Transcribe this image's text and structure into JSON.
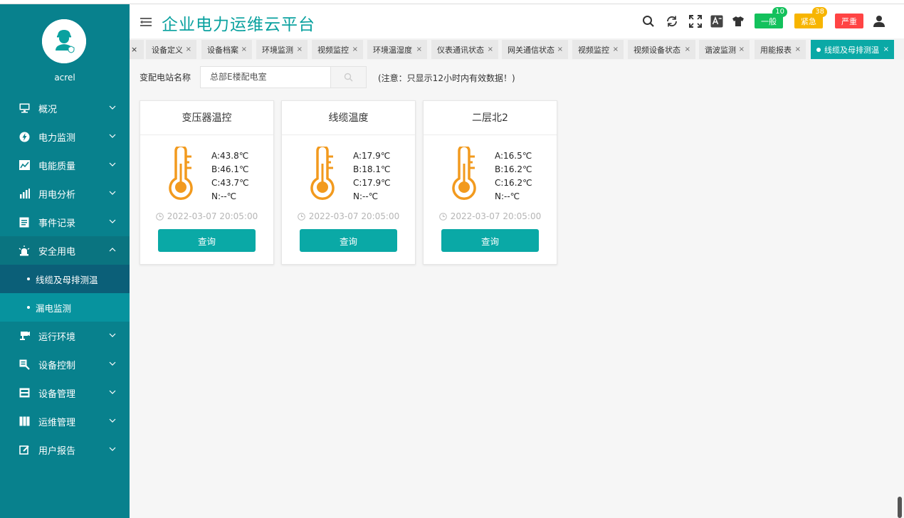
{
  "app": {
    "title": "企业电力运维云平台",
    "username": "acrel"
  },
  "sidebar": {
    "items": [
      {
        "label": "概况",
        "icon": "monitor-icon"
      },
      {
        "label": "电力监测",
        "icon": "power-icon"
      },
      {
        "label": "电能质量",
        "icon": "quality-icon"
      },
      {
        "label": "用电分析",
        "icon": "bar-chart-icon"
      },
      {
        "label": "事件记录",
        "icon": "document-icon"
      },
      {
        "label": "安全用电",
        "icon": "alarm-light-icon"
      },
      {
        "label": "线缆及母排测温",
        "sub": true
      },
      {
        "label": "漏电监测",
        "sub": true
      },
      {
        "label": "运行环境",
        "icon": "camera-icon"
      },
      {
        "label": "设备控制",
        "icon": "control-icon"
      },
      {
        "label": "设备管理",
        "icon": "device-icon"
      },
      {
        "label": "运维管理",
        "icon": "book-icon"
      },
      {
        "label": "用户报告",
        "icon": "edit-icon"
      }
    ]
  },
  "header": {
    "alarms": [
      {
        "label": "一般",
        "count": "10",
        "color": "#13c15c"
      },
      {
        "label": "紧急",
        "count": "38",
        "color": "#f7b500"
      },
      {
        "label": "严重",
        "count": "",
        "color": "#f44"
      }
    ]
  },
  "tabs": [
    {
      "label": "设备定义"
    },
    {
      "label": "设备档案"
    },
    {
      "label": "环境监测"
    },
    {
      "label": "视频监控"
    },
    {
      "label": "环境温湿度"
    },
    {
      "label": "仪表通讯状态"
    },
    {
      "label": "网关通信状态"
    },
    {
      "label": "视频监控"
    },
    {
      "label": "视频设备状态"
    },
    {
      "label": "谐波监测"
    },
    {
      "label": "用能报表"
    },
    {
      "label": "线缆及母排测温"
    }
  ],
  "filter": {
    "station_label": "变配电站名称",
    "station_value": "总部E楼配电室",
    "note": "(注意：只显示12小时内有效数据！)"
  },
  "cards": [
    {
      "title": "变压器温控",
      "a": "A:43.8℃",
      "b": "B:46.1℃",
      "c": "C:43.7℃",
      "n": "N:--℃",
      "time": "2022-03-07 20:05:00",
      "button": "查询"
    },
    {
      "title": "线缆温度",
      "a": "A:17.9℃",
      "b": "B:18.1℃",
      "c": "C:17.9℃",
      "n": "N:--℃",
      "time": "2022-03-07 20:05:00",
      "button": "查询"
    },
    {
      "title": "二层北2",
      "a": "A:16.5℃",
      "b": "B:16.2℃",
      "c": "C:16.2℃",
      "n": "N:--℃",
      "time": "2022-03-07 20:05:00",
      "button": "查询"
    }
  ],
  "colors": {
    "sidebar": "#08818d",
    "accent": "#0aa9a6",
    "thermometer": "#f29a1e"
  }
}
